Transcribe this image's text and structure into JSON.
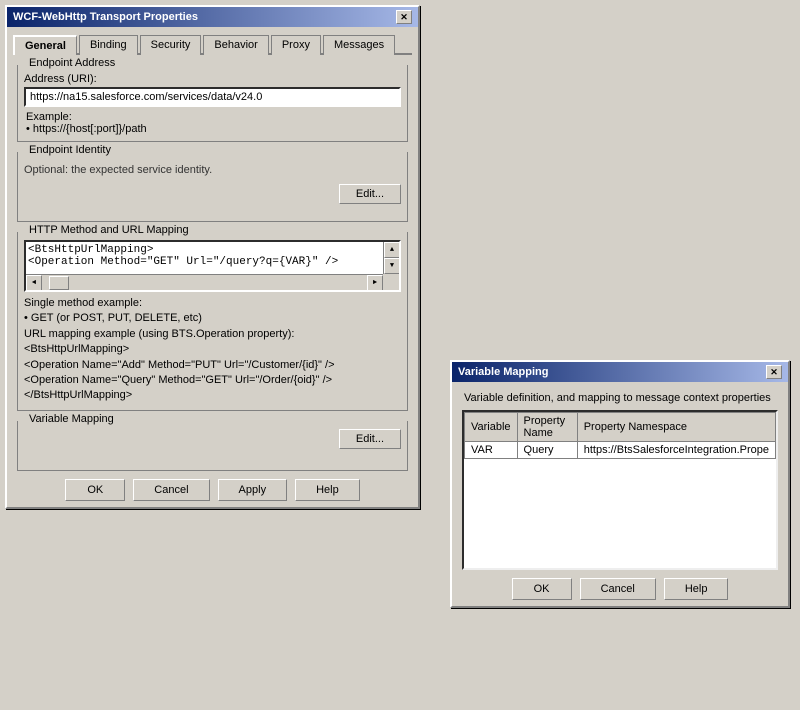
{
  "mainDialog": {
    "title": "WCF-WebHttp Transport Properties",
    "tabs": [
      {
        "label": "General",
        "active": true
      },
      {
        "label": "Binding",
        "active": false
      },
      {
        "label": "Security",
        "active": false
      },
      {
        "label": "Behavior",
        "active": false
      },
      {
        "label": "Proxy",
        "active": false
      },
      {
        "label": "Messages",
        "active": false
      }
    ],
    "endpointAddress": {
      "groupLabel": "Endpoint Address",
      "addressLabel": "Address (URI):",
      "addressValue": "https://na15.salesforce.com/services/data/v24.0",
      "exampleLabel": "Example:",
      "exampleValue": "• https://{host[:port]}/path"
    },
    "endpointIdentity": {
      "groupLabel": "Endpoint Identity",
      "optionalText": "Optional: the expected service identity.",
      "editButton": "Edit..."
    },
    "httpMethod": {
      "groupLabel": "HTTP Method and URL Mapping",
      "content": "<BtsHttpUrlMapping>\n<Operation Method=\"GET\" Url=\"/query?q={VAR}\" />",
      "exampleTitle": "Single method example:",
      "exampleLines": [
        "• GET (or POST, PUT, DELETE, etc)",
        "URL mapping example (using BTS.Operation property):",
        "<BtsHttpUrlMapping>",
        "  <Operation Name=\"Add\" Method=\"PUT\" Url=\"/Customer/{id}\" />",
        "  <Operation Name=\"Query\" Method=\"GET\" Url=\"/Order/{oid}\" />",
        "</BtsHttpUrlMapping>"
      ]
    },
    "variableMapping": {
      "groupLabel": "Variable Mapping",
      "editButton": "Edit..."
    },
    "buttons": {
      "ok": "OK",
      "cancel": "Cancel",
      "apply": "Apply",
      "help": "Help"
    }
  },
  "varMappingDialog": {
    "title": "Variable Mapping",
    "subtitle": "Variable definition, and mapping to message context properties",
    "columns": [
      "Variable",
      "Property Name",
      "Property Namespace"
    ],
    "rows": [
      {
        "variable": "VAR",
        "propertyName": "Query",
        "propertyNamespace": "https://BtsSalesforceIntegration.Prope"
      }
    ],
    "buttons": {
      "ok": "OK",
      "cancel": "Cancel",
      "help": "Help"
    }
  },
  "icons": {
    "close": "✕",
    "scrollUp": "▲",
    "scrollDown": "▼",
    "scrollLeft": "◄",
    "scrollRight": "►"
  }
}
